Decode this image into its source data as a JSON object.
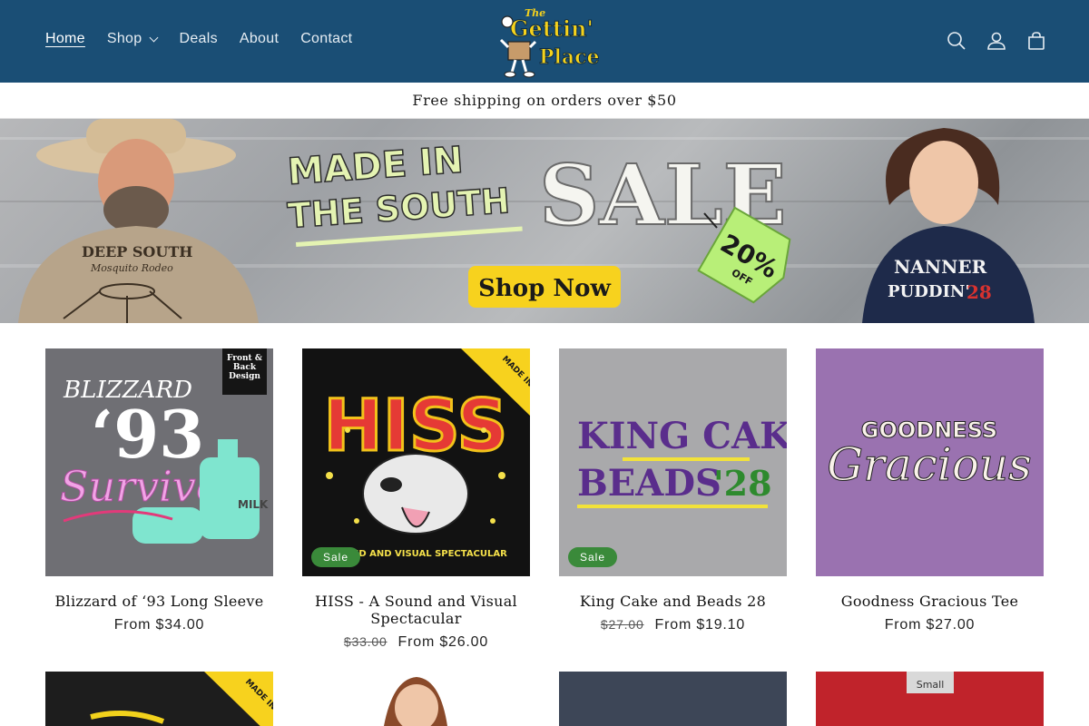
{
  "brand": {
    "logo_line1": "The",
    "logo_line2": "Gettin'",
    "logo_line3": "Place",
    "colors": {
      "header": "#1a4e75",
      "logo_yellow": "#f5d21c",
      "sale_green": "#3a8a3a"
    }
  },
  "nav": {
    "items": [
      {
        "label": "Home",
        "active": true
      },
      {
        "label": "Shop",
        "dropdown": true
      },
      {
        "label": "Deals"
      },
      {
        "label": "About"
      },
      {
        "label": "Contact"
      }
    ]
  },
  "header_icons": [
    "search-icon",
    "account-icon",
    "cart-icon"
  ],
  "announcement": "Free shipping on orders over $50",
  "banner": {
    "headline_small": "MADE IN THE SOUTH",
    "headline_big": "SALE",
    "tag_percent": "20%",
    "tag_off": "OFF",
    "cta": "Shop Now",
    "left_shirt_line1": "DEEP SOUTH",
    "left_shirt_line2": "Mosquito Rodeo",
    "right_shirt_line1": "NANNER",
    "right_shirt_line2": "PUDDIN'",
    "right_shirt_line3": "28"
  },
  "products": [
    {
      "title": "Blizzard of ‘93 Long Sleeve",
      "price": "From $34.00",
      "old_price": null,
      "sale": false,
      "badge": "Front & Back Design",
      "art_line1": "BLIZZARD",
      "art_line2": "‘93",
      "art_line3": "Survivor",
      "art_line4": "MILK"
    },
    {
      "title": "HISS - A Sound and Visual Spectacular",
      "price": "From $26.00",
      "old_price": "$33.00",
      "sale": true,
      "sale_label": "Sale",
      "corner": "MADE IN THE SOUTH",
      "art_line1": "HISS",
      "art_line2": "SOUND AND VISUAL SPECTACULAR"
    },
    {
      "title": "King Cake and Beads 28",
      "price": "From $19.10",
      "old_price": "$27.00",
      "sale": true,
      "sale_label": "Sale",
      "art_line1": "KING CAKE",
      "art_line2": "BEADS",
      "art_line3": "'28"
    },
    {
      "title": "Goodness Gracious Tee",
      "price": "From $27.00",
      "old_price": null,
      "sale": false,
      "art_line1": "GOODNESS",
      "art_line2": "Gracious"
    }
  ],
  "row2": {
    "corner": "MADE IN THE SOUTH",
    "tag_line1": "Small"
  }
}
